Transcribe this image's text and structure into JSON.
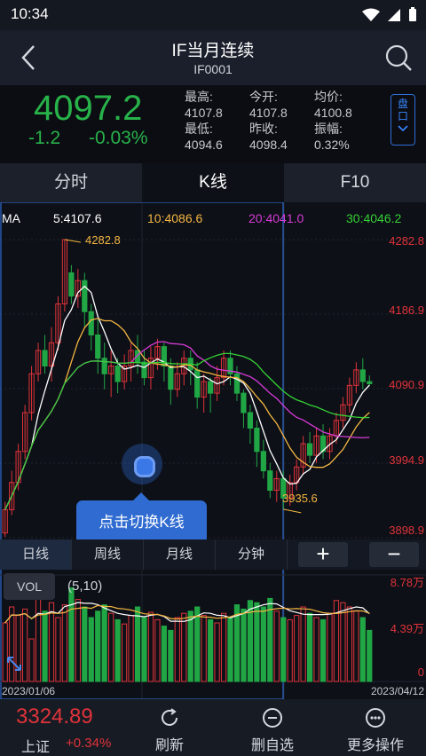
{
  "status": {
    "time": "10:34"
  },
  "header": {
    "title": "IF当月连续",
    "code": "IF0001"
  },
  "quote": {
    "price": "4097.2",
    "change": "-1.2",
    "change_pct": "-0.03%",
    "col1": {
      "high_label": "最高:",
      "high": "4107.8",
      "low_label": "最低:",
      "low": "4094.6"
    },
    "col2": {
      "open_label": "今开:",
      "open": "4107.8",
      "prev_label": "昨收:",
      "prev": "4098.4"
    },
    "col3": {
      "avg_label": "均价:",
      "avg": "4100.8",
      "amp_label": "振幅:",
      "amp": "0.32%"
    },
    "pankou": "盘口"
  },
  "tabs": [
    {
      "label": "分时"
    },
    {
      "label": "K线"
    },
    {
      "label": "F10"
    }
  ],
  "ma_legend": {
    "ma": "MA",
    "ma5": "5:4107.6",
    "ma10": "10:4086.6",
    "ma20": "20:4041.0",
    "ma30": "30:4046.2"
  },
  "y_labels": [
    "4282.8",
    "4186.9",
    "4090.9",
    "3994.9",
    "3898.9"
  ],
  "annotations": {
    "high": "4282.8",
    "low": "3935.6"
  },
  "tooltip": "点击切换K线",
  "periods": [
    {
      "label": "日线"
    },
    {
      "label": "周线"
    },
    {
      "label": "月线"
    },
    {
      "label": "分钟"
    }
  ],
  "zoom": {
    "in": "+",
    "out": "−"
  },
  "volume": {
    "label": "VOL",
    "params": "(5,10)",
    "labels": [
      "8.78万",
      "4.39万",
      "0"
    ]
  },
  "dates": {
    "start": "2023/01/06",
    "end": "2023/04/12"
  },
  "bottom": {
    "index_value": "3324.89",
    "index_name": "上证",
    "index_pct": "+0.34%",
    "refresh": "刷新",
    "remove": "删自选",
    "more": "更多操作"
  },
  "colors": {
    "up": "#e0333a",
    "down": "#21a645",
    "ma5": "#ffffff",
    "ma10": "#f5b642",
    "ma20": "#d63bd6",
    "ma30": "#35d135",
    "accent": "#2f6bd1"
  },
  "chart_data": {
    "type": "candlestick",
    "ylim": [
      3898.9,
      4282.8
    ],
    "candles": [
      [
        3905,
        3935,
        3900,
        3945
      ],
      [
        3935,
        3970,
        3928,
        3985
      ],
      [
        3970,
        4010,
        3960,
        4020
      ],
      [
        4010,
        4060,
        4000,
        4070
      ],
      [
        4060,
        4110,
        4050,
        4120
      ],
      [
        4110,
        4140,
        4100,
        4150
      ],
      [
        4140,
        4120,
        4110,
        4160
      ],
      [
        4120,
        4150,
        4100,
        4170
      ],
      [
        4150,
        4200,
        4140,
        4210
      ],
      [
        4200,
        4282.8,
        4190,
        4282.8
      ],
      [
        4240,
        4210,
        4200,
        4250
      ],
      [
        4210,
        4230,
        4195,
        4245
      ],
      [
        4230,
        4190,
        4170,
        4240
      ],
      [
        4190,
        4160,
        4140,
        4200
      ],
      [
        4160,
        4130,
        4110,
        4180
      ],
      [
        4130,
        4110,
        4090,
        4150
      ],
      [
        4110,
        4120,
        4080,
        4140
      ],
      [
        4120,
        4100,
        4085,
        4130
      ],
      [
        4100,
        4120,
        4090,
        4135
      ],
      [
        4120,
        4140,
        4100,
        4150
      ],
      [
        4140,
        4125,
        4110,
        4160
      ],
      [
        4125,
        4105,
        4095,
        4140
      ],
      [
        4105,
        4130,
        4090,
        4145
      ],
      [
        4130,
        4145,
        4115,
        4155
      ],
      [
        4145,
        4120,
        4100,
        4150
      ],
      [
        4120,
        4090,
        4070,
        4130
      ],
      [
        4090,
        4110,
        4080,
        4125
      ],
      [
        4110,
        4130,
        4095,
        4140
      ],
      [
        4130,
        4115,
        4095,
        4140
      ],
      [
        4115,
        4080,
        4065,
        4125
      ],
      [
        4080,
        4100,
        4060,
        4110
      ],
      [
        4100,
        4085,
        4060,
        4105
      ],
      [
        4085,
        4105,
        4075,
        4120
      ],
      [
        4105,
        4130,
        4095,
        4140
      ],
      [
        4130,
        4110,
        4095,
        4140
      ],
      [
        4110,
        4085,
        4075,
        4120
      ],
      [
        4085,
        4060,
        4040,
        4090
      ],
      [
        4060,
        4040,
        4020,
        4070
      ],
      [
        4040,
        4010,
        3990,
        4050
      ],
      [
        4010,
        3985,
        3975,
        4025
      ],
      [
        3985,
        3960,
        3950,
        3995
      ],
      [
        3960,
        3975,
        3945,
        3985
      ],
      [
        3975,
        3950,
        3935.6,
        3985
      ],
      [
        3950,
        3970,
        3940,
        3980
      ],
      [
        3970,
        3990,
        3960,
        4000
      ],
      [
        3990,
        4020,
        3980,
        4030
      ],
      [
        4020,
        4005,
        3995,
        4035
      ],
      [
        4005,
        4030,
        3995,
        4040
      ],
      [
        4030,
        4010,
        4000,
        4045
      ],
      [
        4010,
        4030,
        4000,
        4040
      ],
      [
        4030,
        4050,
        4020,
        4060
      ],
      [
        4050,
        4070,
        4040,
        4080
      ],
      [
        4070,
        4095,
        4060,
        4105
      ],
      [
        4095,
        4115,
        4085,
        4125
      ],
      [
        4115,
        4100,
        4090,
        4130
      ],
      [
        4100,
        4097.2,
        4094.6,
        4107.8
      ]
    ],
    "volumes": [
      55,
      70,
      62,
      68,
      40,
      80,
      66,
      74,
      60,
      72,
      88,
      77,
      70,
      60,
      66,
      72,
      64,
      58,
      54,
      62,
      70,
      60,
      65,
      58,
      52,
      48,
      60,
      64,
      66,
      70,
      62,
      58,
      55,
      64,
      60,
      72,
      68,
      76,
      74,
      70,
      78,
      66,
      60,
      58,
      62,
      70,
      64,
      60,
      58,
      64,
      76,
      74,
      70,
      66,
      60,
      48
    ]
  }
}
